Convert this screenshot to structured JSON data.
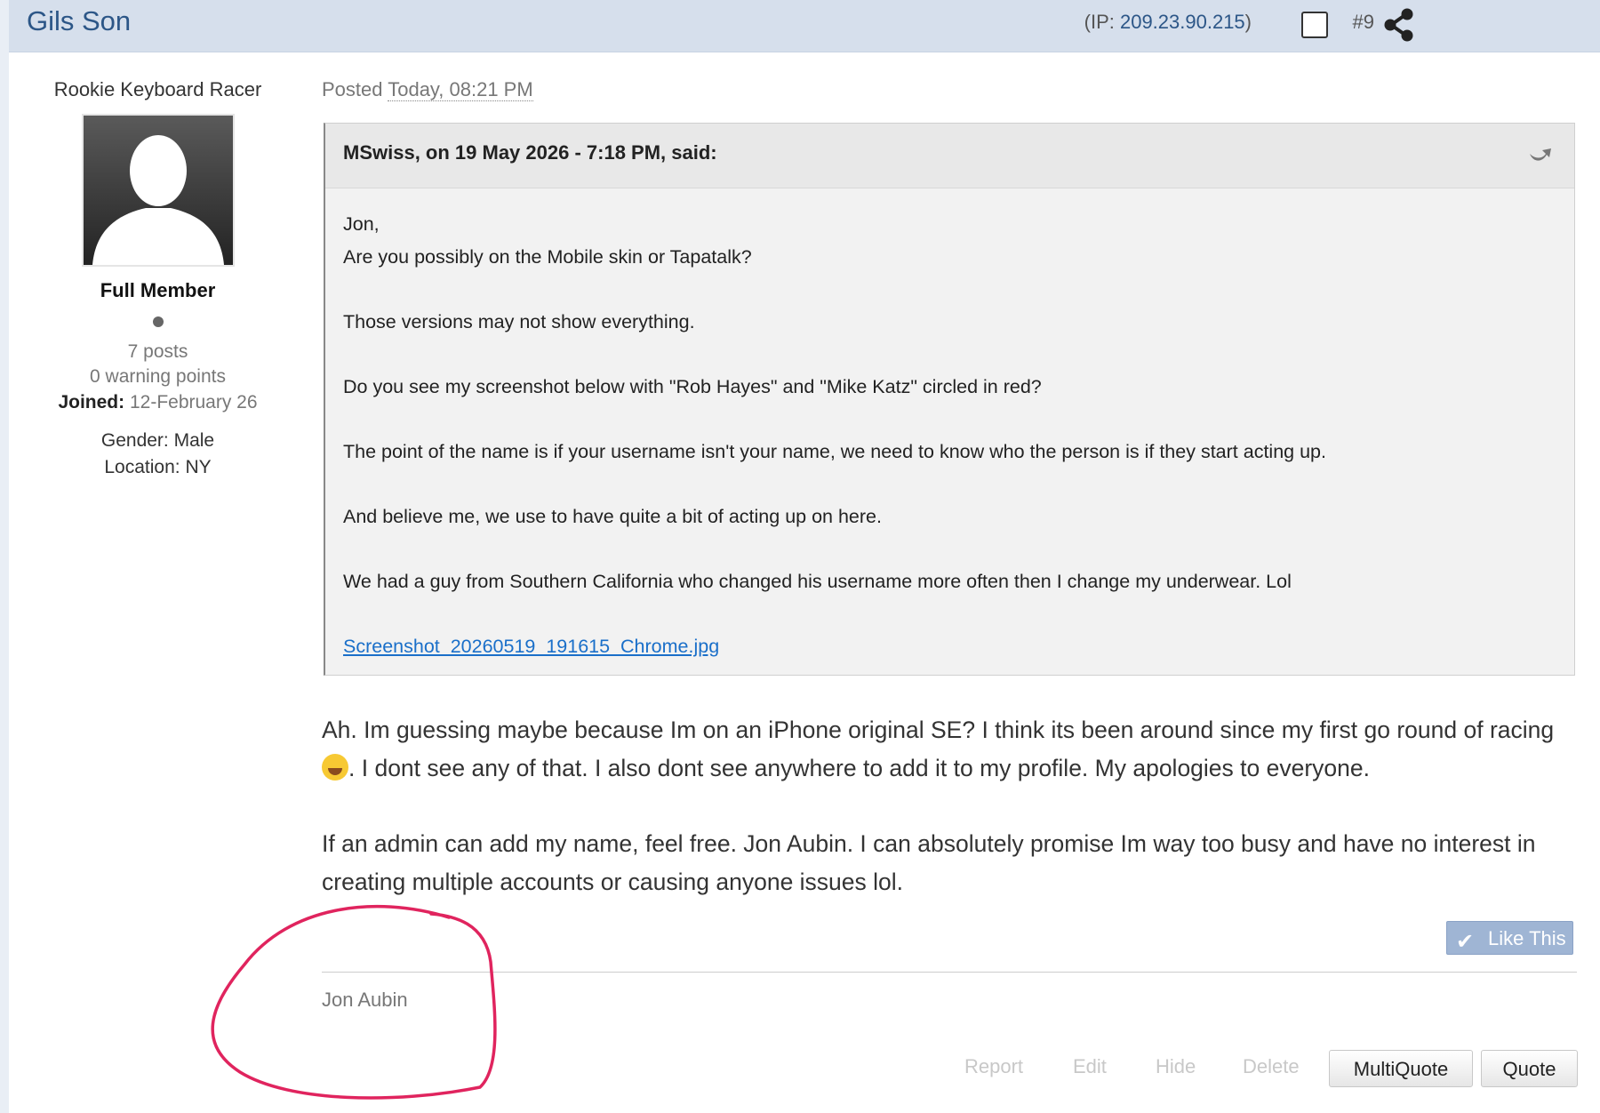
{
  "header": {
    "author": "Gils Son",
    "ip_prefix": "(IP: ",
    "ip": "209.23.90.215",
    "ip_suffix": ")",
    "post_number": "#9",
    "share_icon": "share-icon"
  },
  "sidebar": {
    "rank_title": "Rookie Keyboard Racer",
    "group": "Full Member",
    "posts": "7 posts",
    "warning_points": "0 warning points",
    "joined_label": "Joined:",
    "joined_value": "12-February 26",
    "gender": "Gender: Male",
    "location": "Location: NY"
  },
  "post": {
    "posted_label": "Posted",
    "posted_date": "Today, 08:21 PM"
  },
  "quote": {
    "citation": "MSwiss, on 19 May 2026 - 7:18 PM, said:",
    "line1": "Jon,",
    "line2": "Are you possibly on the Mobile skin or Tapatalk?",
    "line3": "Those versions may not show everything.",
    "line4": "Do you see my screenshot below with \"Rob Hayes\" and \"Mike Katz\" circled in red?",
    "line5": "The point of the name is if your username isn't your name, we need to know who the person is if they start acting up.",
    "line6": "And believe me, we use to have quite a bit of acting up on here.",
    "line7": "We had a guy from Southern California who changed his username more often then I change my underwear. Lol",
    "attachment": "Screenshot_20260519_191615_Chrome.jpg"
  },
  "reply": {
    "para1_a": "Ah. Im guessing maybe because Im on an iPhone original SE? I think its been around since my first go round of racing",
    "para1_b": ". I dont see any of that. I also dont see anywhere to add it to my profile. My apologies to everyone.",
    "para2": "If an admin can add my name, feel free. Jon Aubin. I can absolutely promise Im way too busy and have no interest in creating multiple accounts or causing anyone issues lol."
  },
  "like_label": "Like This",
  "signature": "Jon Aubin",
  "actions": {
    "report": "Report",
    "edit": "Edit",
    "hide": "Hide",
    "delete": "Delete",
    "multiquote": "MultiQuote",
    "quote": "Quote"
  },
  "colors": {
    "header_bg": "#d6dfec",
    "link": "#2c5687",
    "annotation": "#e0245e"
  }
}
